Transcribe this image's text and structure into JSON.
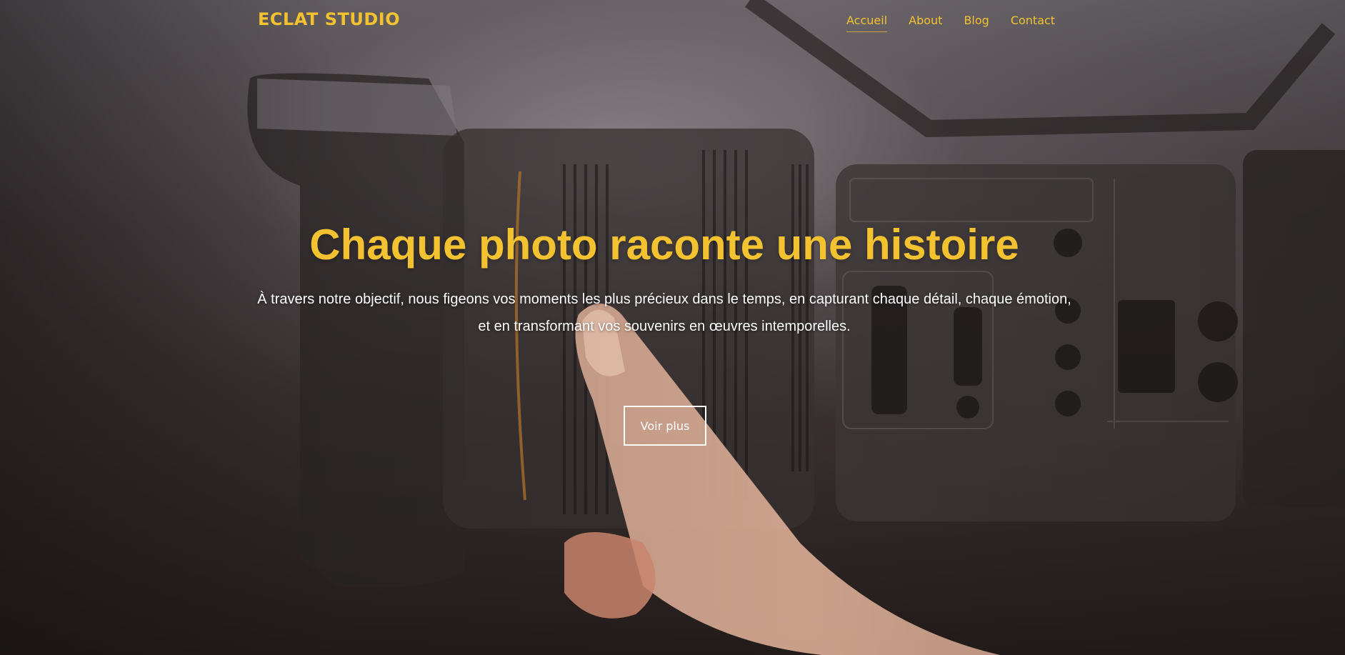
{
  "brand": {
    "name": "ECLAT STUDIO",
    "color": "#f2c230"
  },
  "nav": {
    "items": [
      {
        "label": "Accueil",
        "active": true
      },
      {
        "label": "About",
        "active": false
      },
      {
        "label": "Blog",
        "active": false
      },
      {
        "label": "Contact",
        "active": false
      }
    ]
  },
  "hero": {
    "title": "Chaque photo raconte une histoire",
    "text": "À travers notre objectif, nous figeons vos moments les plus précieux dans le temps, en capturant chaque détail, chaque émotion, et en transformant vos souvenirs en œuvres intemporelles.",
    "cta_label": "Voir plus",
    "background_image": "video-camera-with-finger-on-lens"
  },
  "colors": {
    "accent": "#f2c230",
    "text_light": "#ffffff"
  }
}
